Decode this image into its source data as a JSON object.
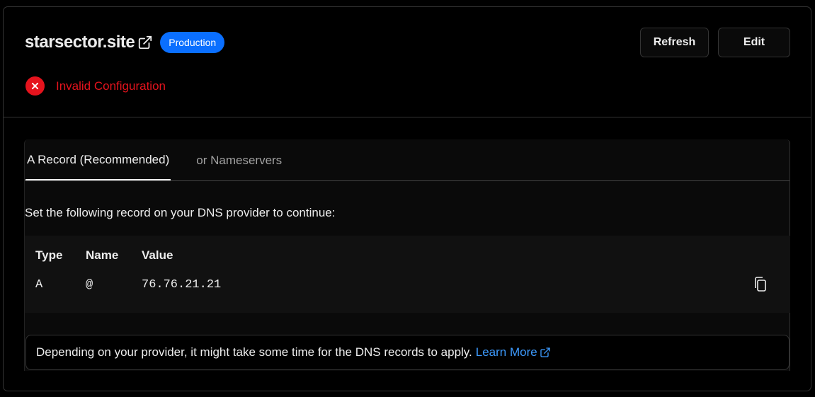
{
  "domain": {
    "name": "starsector.site",
    "badge": "Production"
  },
  "actions": {
    "refresh_label": "Refresh",
    "edit_label": "Edit"
  },
  "status": {
    "text": "Invalid Configuration",
    "color": "#e5131d"
  },
  "tabs": [
    {
      "label": "A Record (Recommended)",
      "active": true
    },
    {
      "label": "or Nameservers",
      "active": false
    }
  ],
  "instruction": "Set the following record on your DNS provider to continue:",
  "record": {
    "headers": {
      "type": "Type",
      "name": "Name",
      "value": "Value"
    },
    "row": {
      "type": "A",
      "name": "@",
      "value": "76.76.21.21"
    }
  },
  "note": {
    "text": "Depending on your provider, it might take some time for the DNS records to apply.",
    "link_label": "Learn More"
  },
  "colors": {
    "accent": "#0a6fff",
    "link": "#3d9bff",
    "error": "#e5131d"
  }
}
